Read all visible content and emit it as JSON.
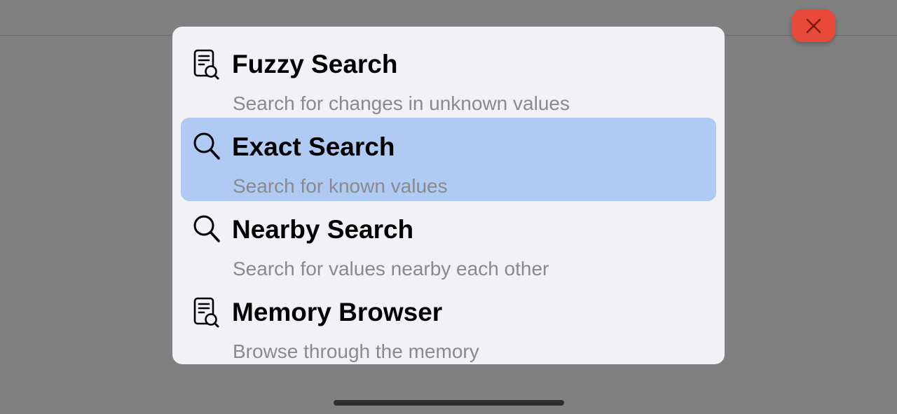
{
  "close_button": {
    "icon": "close-icon",
    "color": "#e8493b"
  },
  "menu": {
    "items": [
      {
        "icon": "document-search-icon",
        "title": "Fuzzy Search",
        "subtitle": "Search for changes in unknown values",
        "selected": false
      },
      {
        "icon": "magnifier-icon",
        "title": "Exact Search",
        "subtitle": "Search for known values",
        "selected": true
      },
      {
        "icon": "magnifier-icon",
        "title": "Nearby Search",
        "subtitle": "Search for values nearby each other",
        "selected": false
      },
      {
        "icon": "document-search-icon",
        "title": "Memory Browser",
        "subtitle": "Browse through the memory",
        "selected": false
      }
    ]
  },
  "colors": {
    "selected_background": "#b0cbf3",
    "menu_background": "#f2f1f6",
    "subtitle_text": "#8a8a8e",
    "dimmed_backdrop": "#808080"
  }
}
